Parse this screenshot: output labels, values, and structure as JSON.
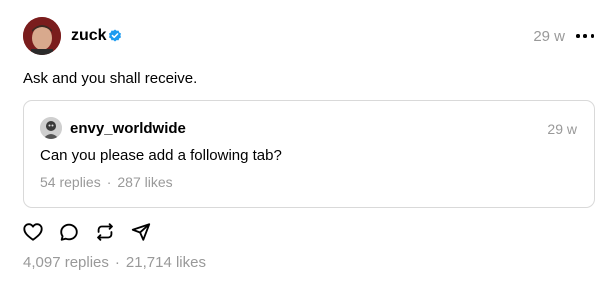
{
  "post": {
    "username": "zuck",
    "time": "29 w",
    "text": "Ask and you shall receive.",
    "replies": "4,097 replies",
    "separator": "·",
    "likes": "21,714 likes"
  },
  "quoted": {
    "username": "envy_worldwide",
    "time": "29 w",
    "text": "Can you please add a following tab?",
    "replies": "54 replies",
    "separator": "·",
    "likes": "287 likes"
  },
  "icons": {
    "verified": "verified-badge-icon",
    "more": "more-options-icon",
    "like": "heart-icon",
    "reply": "comment-icon",
    "repost": "repost-icon",
    "share": "send-icon"
  },
  "colors": {
    "verified": "#1d9bf0",
    "muted": "#999999",
    "border": "#d9d9d9"
  }
}
